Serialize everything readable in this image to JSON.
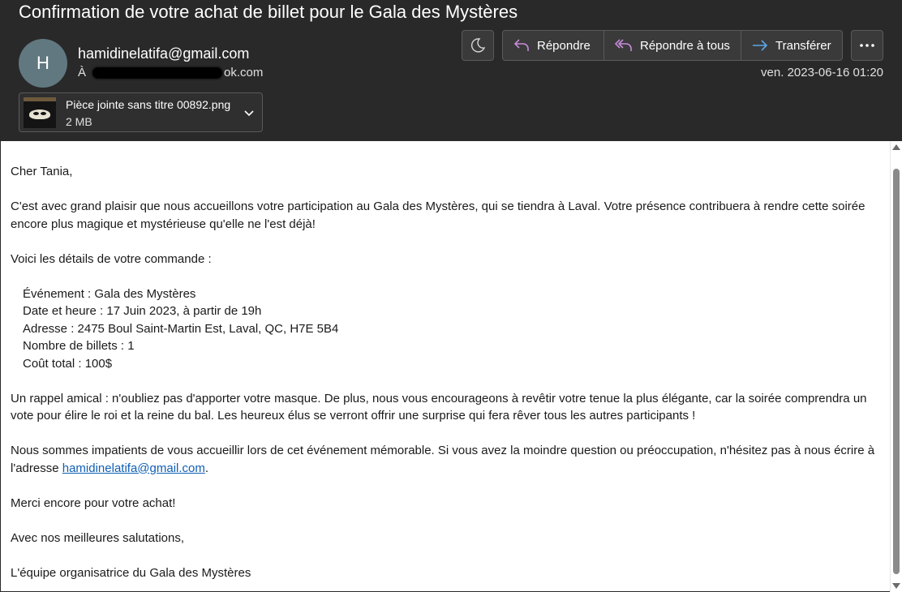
{
  "header": {
    "subject": "Confirmation de votre achat de billet pour le Gala des Mystères",
    "avatar_initial": "H",
    "sender": "hamidinelatifa@gmail.com",
    "to_prefix": "À",
    "to_visible_suffix": "ok.com",
    "date": "ven. 2023-06-16 01:20"
  },
  "attachment": {
    "name": "Pièce jointe sans titre 00892.png",
    "size": "2 MB"
  },
  "toolbar": {
    "reply_label": "Répondre",
    "reply_all_label": "Répondre à tous",
    "forward_label": "Transférer",
    "icons": {
      "theme": "moon-icon",
      "reply": "reply-arrow-icon",
      "reply_all": "reply-all-arrow-icon",
      "forward": "forward-arrow-icon",
      "more": "ellipsis-icon"
    },
    "colors": {
      "reply_icon": "#c78bd8",
      "forward_icon": "#5aa6e8"
    }
  },
  "body": {
    "greeting": "Cher Tania,",
    "intro": "C'est avec grand plaisir que nous accueillons votre participation au Gala des Mystères, qui se tiendra à Laval. Votre présence contribuera à rendre cette soirée encore plus magique et mystérieuse qu'elle ne l'est déjà!",
    "details_intro": "Voici les détails de votre commande :",
    "details": [
      "Événement : Gala des Mystères",
      "Date et heure : 17 Juin 2023, à partir de 19h",
      "Adresse : 2475 Boul Saint-Martin Est, Laval, QC, H7E 5B4",
      "Nombre de billets : 1",
      "Coût total : 100$"
    ],
    "reminder": "Un rappel amical : n'oubliez pas d'apporter votre masque. De plus, nous vous encourageons à revêtir votre tenue la plus élégante, car la soirée comprendra un vote pour élire le roi et la reine du bal. Les heureux élus se verront offrir une surprise qui fera rêver tous les autres participants !",
    "contact_text": "Nous sommes impatients de vous accueillir lors de cet événement mémorable. Si vous avez la moindre question ou préoccupation, n'hésitez pas à nous écrire à l'adresse ",
    "contact_link": "hamidinelatifa@gmail.com",
    "contact_end": ".",
    "thanks": "Merci encore pour votre achat!",
    "closing": "Avec nos meilleures salutations,",
    "signature": "L'équipe organisatrice du Gala des Mystères"
  }
}
